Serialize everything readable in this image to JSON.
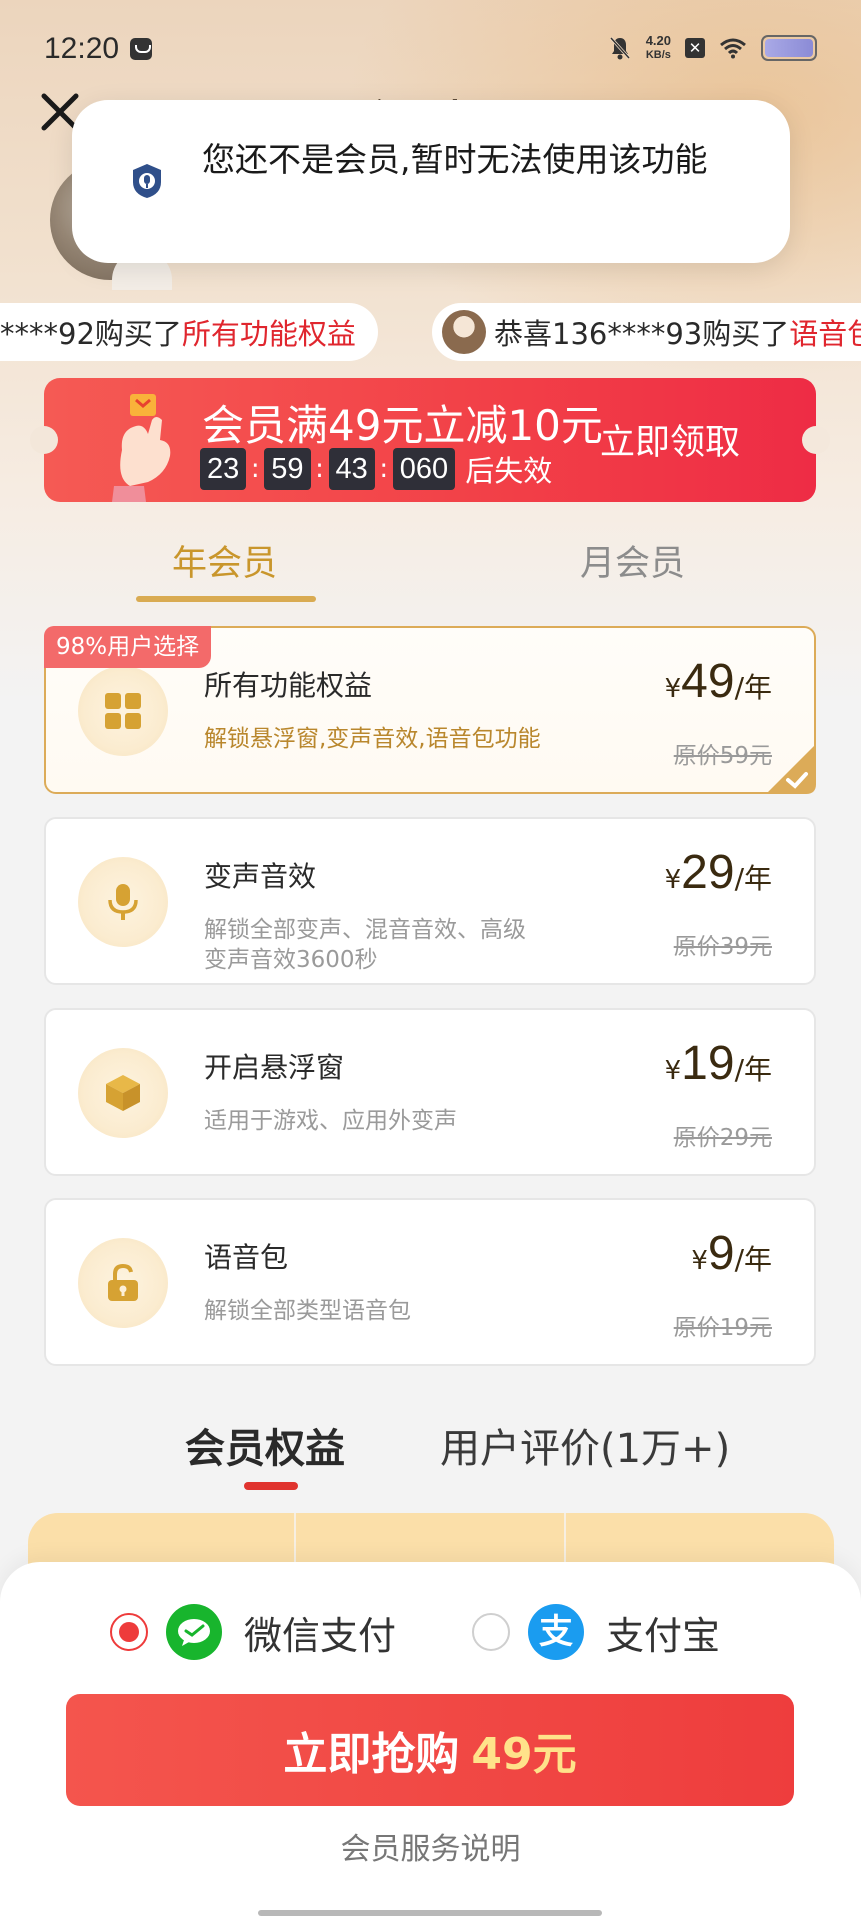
{
  "status_bar": {
    "time": "12:20",
    "net_speed_value": "4.20",
    "net_speed_unit": "KB/s"
  },
  "header": {
    "title": "会员中心"
  },
  "toast": {
    "message": "您还不是会员,暂时无法使用该功能"
  },
  "ticker": {
    "item1_prefix": "****92购买了",
    "item1_highlight": "所有功能权益",
    "item2_prefix": "恭喜136****93购买了",
    "item2_highlight": "语音包"
  },
  "coupon": {
    "title": "会员满49元立减10元",
    "timer": {
      "hours": "23",
      "minutes": "59",
      "seconds": "43",
      "ms": "060"
    },
    "timer_suffix": "后失效",
    "cta": "立即领取"
  },
  "plan_tabs": {
    "year": "年会员",
    "month": "月会员"
  },
  "plans": [
    {
      "badge": "98%用户选择",
      "name": "所有功能权益",
      "desc": "解锁悬浮窗,变声音效,语音包功能",
      "currency": "¥",
      "price": "49",
      "unit": "/年",
      "original": "原价59元",
      "icon": "grid-icon"
    },
    {
      "name": "变声音效",
      "desc": "解锁全部变声、混音音效、高级变声音效3600秒",
      "currency": "¥",
      "price": "29",
      "unit": "/年",
      "original": "原价39元",
      "icon": "microphone-icon"
    },
    {
      "name": "开启悬浮窗",
      "desc": "适用于游戏、应用外变声",
      "currency": "¥",
      "price": "19",
      "unit": "/年",
      "original": "原价29元",
      "icon": "cube-icon"
    },
    {
      "name": "语音包",
      "desc": "解锁全部类型语音包",
      "currency": "¥",
      "price": "9",
      "unit": "/年",
      "original": "原价19元",
      "icon": "unlock-icon"
    }
  ],
  "benefit_tabs": {
    "benefits": "会员权益",
    "reviews": "用户评价(1万+)"
  },
  "payment": {
    "wechat": "微信支付",
    "alipay": "支付宝",
    "alipay_glyph": "支",
    "selected": "wechat"
  },
  "buy": {
    "label": "立即抢购",
    "price": "49元"
  },
  "service_link": "会员服务说明",
  "colors": {
    "accent_red": "#ee3d3d",
    "gold": "#c9962c",
    "price_highlight": "#ffe28a"
  }
}
